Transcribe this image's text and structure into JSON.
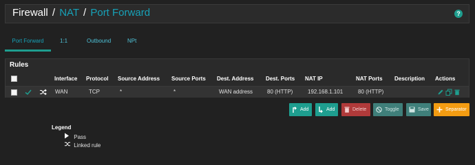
{
  "breadcrumb": {
    "root": "Firewall",
    "sep1": "/",
    "section": "NAT",
    "sep2": "/",
    "page": "Port Forward"
  },
  "help_icon": "?",
  "tabs": [
    {
      "label": "Port Forward",
      "active": true
    },
    {
      "label": "1:1",
      "active": false
    },
    {
      "label": "Outbound",
      "active": false
    },
    {
      "label": "NPt",
      "active": false
    }
  ],
  "rules": {
    "title": "Rules",
    "columns": [
      "Interface",
      "Protocol",
      "Source Address",
      "Source Ports",
      "Dest. Address",
      "Dest. Ports",
      "NAT IP",
      "NAT Ports",
      "Description",
      "Actions"
    ],
    "row": {
      "status_icon": "check-icon",
      "type_icon": "shuffle-icon",
      "interface": "WAN",
      "protocol": "TCP",
      "source_address": "*",
      "source_ports": "*",
      "dest_address": "WAN address",
      "dest_ports": "80 (HTTP)",
      "nat_ip": "192.168.1.101",
      "nat_ports": "80 (HTTP)",
      "description": ""
    }
  },
  "buttons": {
    "add_top": "Add",
    "add_bottom": "Add",
    "delete": "Delete",
    "toggle": "Toggle",
    "save": "Save",
    "separator": "Separator"
  },
  "legend": {
    "title": "Legend",
    "pass": "Pass",
    "linked": "Linked rule"
  },
  "colors": {
    "accent_teal": "#1e9e8f",
    "link": "#17a2b8",
    "delete": "#b03a3a",
    "separator": "#f39c12"
  }
}
